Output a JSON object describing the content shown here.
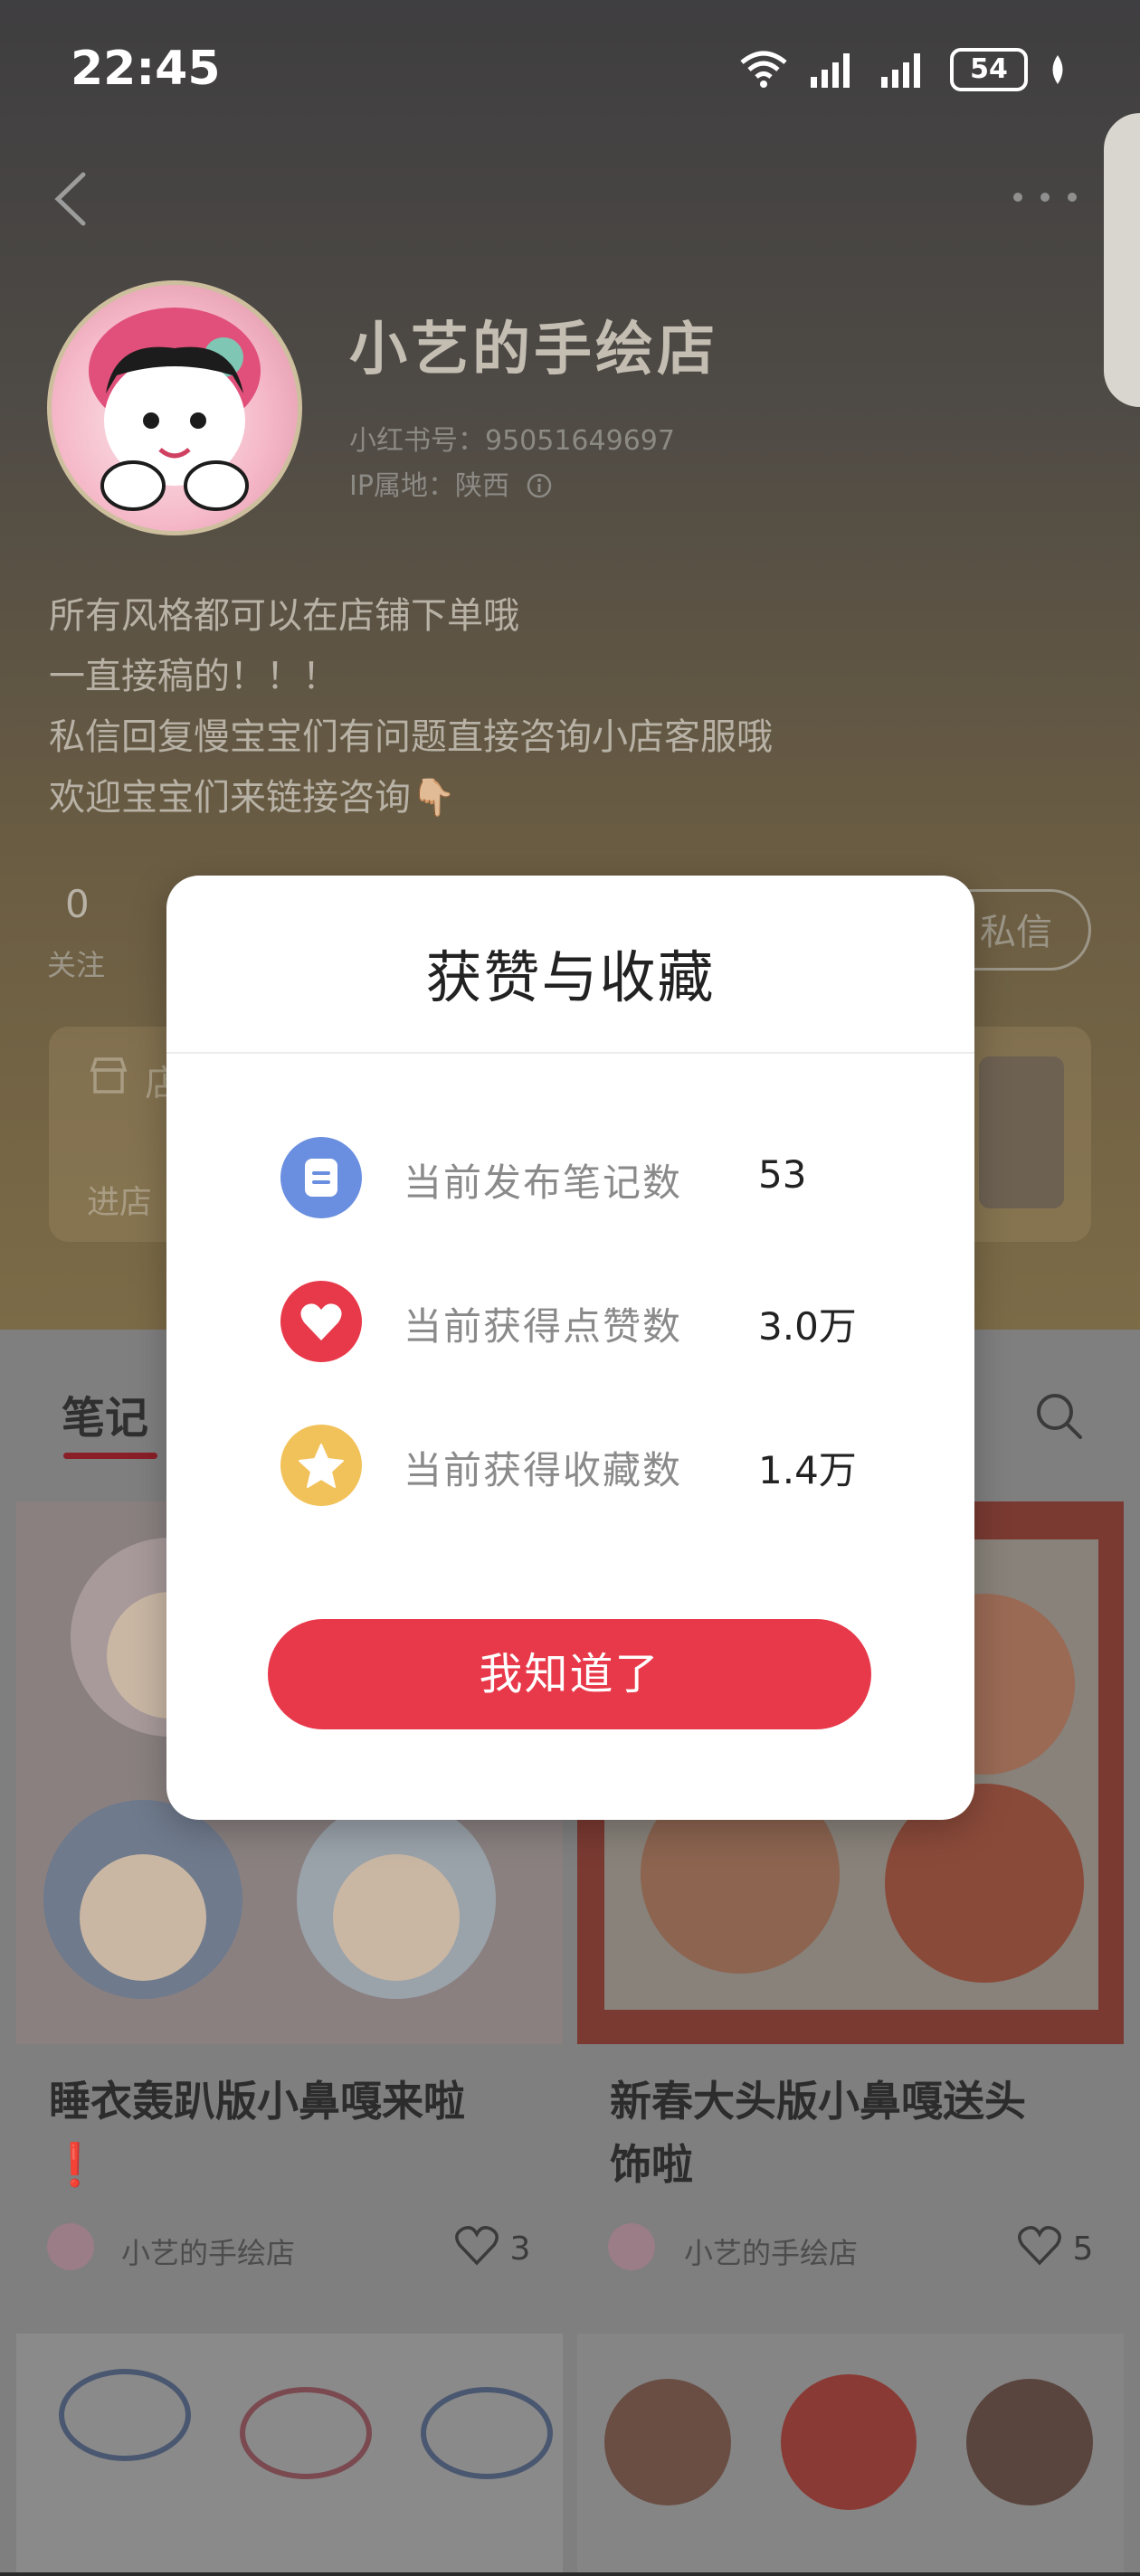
{
  "status_bar": {
    "time": "22:45",
    "battery": "54"
  },
  "profile": {
    "shop_name": "小艺的手绘店",
    "xhs_id": "小红书号：95051649697",
    "ip_location": "IP属地：陕西",
    "bio": [
      "所有风格都可以在店铺下单哦",
      "一直接稿的！！！",
      "私信回复慢宝宝们有问题直接咨询小店客服哦",
      "欢迎宝宝们来链接咨询👇🏼"
    ],
    "following_count": "0",
    "following_label": "关注",
    "message_button": "私信",
    "store_title": "店",
    "store_enter": "进店"
  },
  "tabs": {
    "notes_label": "笔记"
  },
  "notes": [
    {
      "title_line1": "睡衣轰趴版小鼻嘎来啦",
      "title_line2": "❗",
      "author": "小艺的手绘店",
      "likes": "3"
    },
    {
      "title_line1": "新春大头版小鼻嘎送头",
      "title_line2": "饰啦",
      "author": "小艺的手绘店",
      "likes": "5"
    }
  ],
  "modal": {
    "title": "获赞与收藏",
    "stats": [
      {
        "label": "当前发布笔记数",
        "value": "53",
        "icon": "notes-icon",
        "color": "#6b8fe0"
      },
      {
        "label": "当前获得点赞数",
        "value": "3.0万",
        "icon": "heart-icon",
        "color": "#e8394a"
      },
      {
        "label": "当前获得收藏数",
        "value": "1.4万",
        "icon": "star-icon",
        "color": "#f2c25a"
      }
    ],
    "confirm_button": "我知道了"
  },
  "colors": {
    "accent": "#e8394a",
    "overlay_tint": "#7f7f7f"
  }
}
